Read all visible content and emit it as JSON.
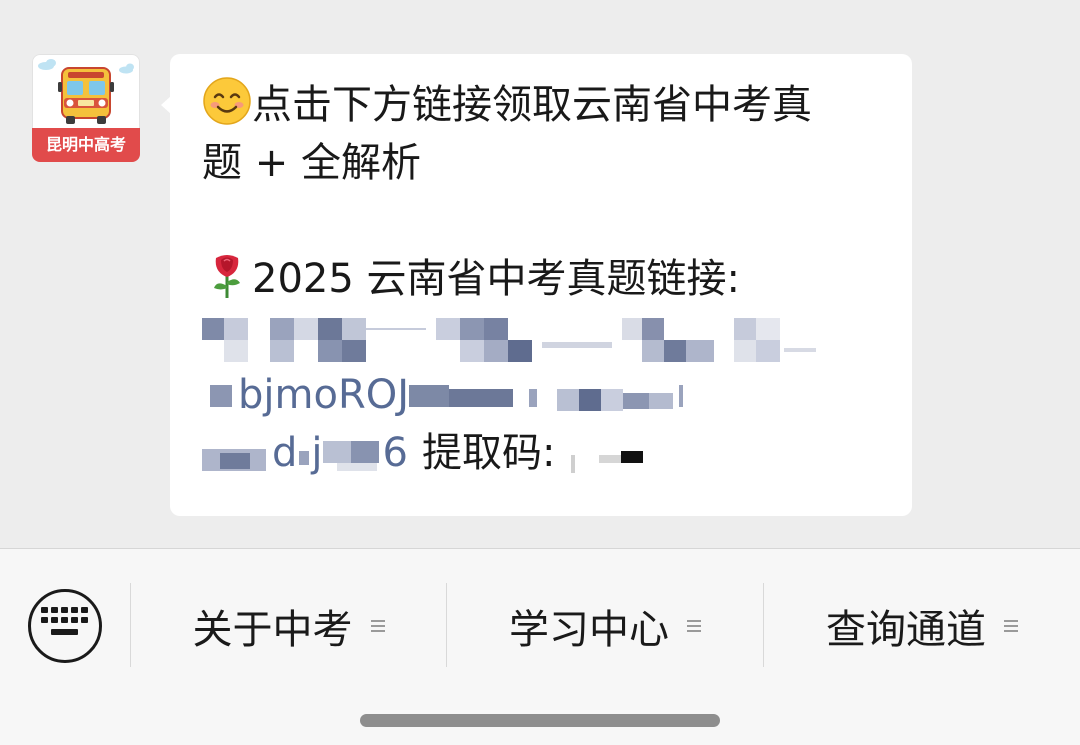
{
  "chat": {
    "avatar": {
      "icon": "school-bus-icon",
      "label": "昆明中高考"
    },
    "message": {
      "line1": "点击下方链接领取云南省中考真",
      "line2": "题 + 全解析",
      "link_heading": "2025 云南省中考真题链接:",
      "link_fragment_a": "bjmoROJ",
      "link_fragment_b": "d",
      "link_fragment_c": "j",
      "link_fragment_d": "6",
      "code_label": "提取码:",
      "emoji_1": "smiling-face-icon",
      "emoji_2": "rose-icon"
    }
  },
  "menu": {
    "keyboard_icon": "keyboard-icon",
    "items": [
      {
        "label": "关于中考"
      },
      {
        "label": "学习中心"
      },
      {
        "label": "查询通道"
      }
    ]
  },
  "colors": {
    "link": "#576b95",
    "background": "#ededed",
    "menu_background": "#f7f7f7",
    "avatar_label": "#e14b4b"
  }
}
